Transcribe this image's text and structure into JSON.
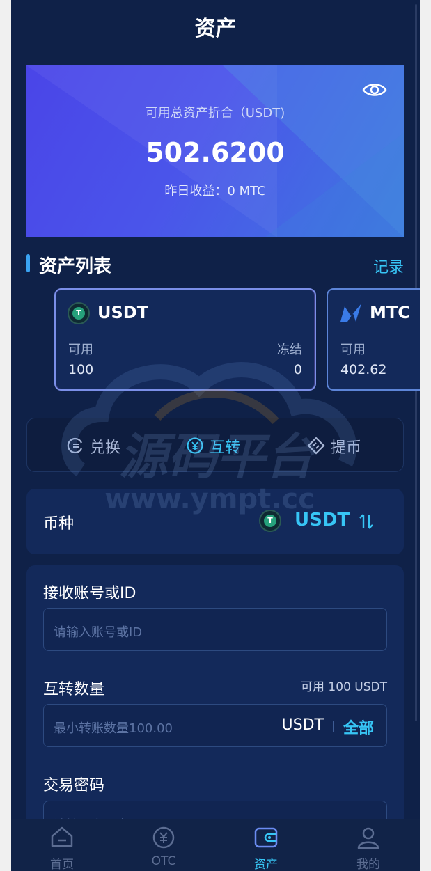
{
  "page": {
    "title": "资产"
  },
  "balance_card": {
    "label": "可用总资产折合（USDT)",
    "amount": "502.6200",
    "yesterday": "昨日收益：0 MTC"
  },
  "asset_list": {
    "title": "资产列表",
    "record_link": "记录",
    "coins": [
      {
        "name": "USDT",
        "available_label": "可用",
        "available": "100",
        "frozen_label": "冻结",
        "frozen": "0"
      },
      {
        "name": "MTC",
        "available_label": "可用",
        "available": "402.62"
      }
    ]
  },
  "actions": [
    {
      "label": "兑换",
      "icon": "exchange-icon",
      "active": false
    },
    {
      "label": "互转",
      "icon": "yen-transfer-icon",
      "active": true
    },
    {
      "label": "提币",
      "icon": "withdraw-icon",
      "active": false
    }
  ],
  "currency_row": {
    "label": "币种",
    "value": "USDT"
  },
  "form": {
    "account": {
      "label": "接收账号或ID",
      "placeholder": "请输入账号或ID"
    },
    "amount": {
      "label": "互转数量",
      "available": "可用 100 USDT",
      "placeholder": "最小转账数量100.00",
      "unit": "USDT",
      "all_label": "全部"
    },
    "password": {
      "label": "交易密码",
      "placeholder": "请输入交易密码"
    }
  },
  "watermark": {
    "line1": "源码平台",
    "line2": "www.ympt.cc"
  },
  "bottom_nav": [
    {
      "label": "首页",
      "icon": "home-icon",
      "active": false
    },
    {
      "label": "OTC",
      "icon": "otc-icon",
      "active": false
    },
    {
      "label": "资产",
      "icon": "wallet-icon",
      "active": true
    },
    {
      "label": "我的",
      "icon": "user-icon",
      "active": false
    }
  ],
  "colors": {
    "background": "#0f2148",
    "panel": "#13295a",
    "accent": "#37c5f5",
    "card_gradient_start": "#4a45e8",
    "card_gradient_end": "#3f78df"
  }
}
